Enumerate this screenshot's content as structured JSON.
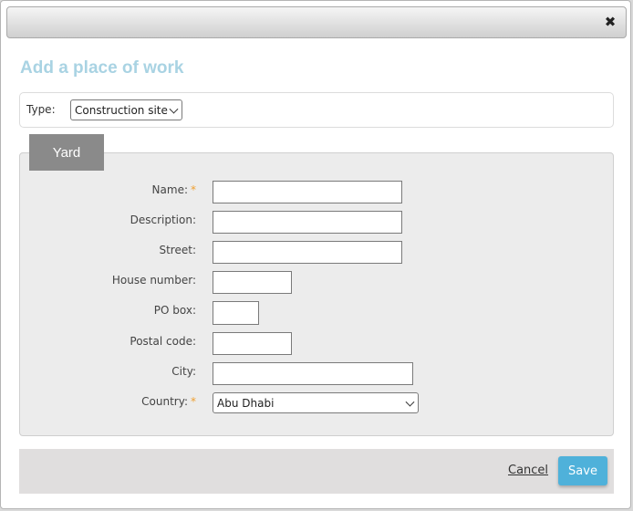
{
  "dialog": {
    "title": "Add a place of work",
    "close_glyph": "✖",
    "close_icon": "close-icon"
  },
  "type_row": {
    "label": "Type:",
    "selected": "Construction site"
  },
  "panel": {
    "tab_label": "Yard",
    "fields": {
      "name": {
        "label": "Name:",
        "required": "*",
        "value": ""
      },
      "description": {
        "label": "Description:",
        "value": ""
      },
      "street": {
        "label": "Street:",
        "value": ""
      },
      "house_number": {
        "label": "House number:",
        "value": ""
      },
      "po_box": {
        "label": "PO box:",
        "value": ""
      },
      "postal_code": {
        "label": "Postal code:",
        "value": ""
      },
      "city": {
        "label": "City:",
        "value": ""
      },
      "country": {
        "label": "Country:",
        "required": "*",
        "selected": "Abu Dhabi"
      }
    }
  },
  "footer": {
    "cancel_label": "Cancel",
    "save_label": "Save"
  },
  "colors": {
    "title": "#a9d3e3",
    "required": "#f0a030",
    "save_button": "#4fb1da",
    "tab": "#8a8a8a"
  }
}
